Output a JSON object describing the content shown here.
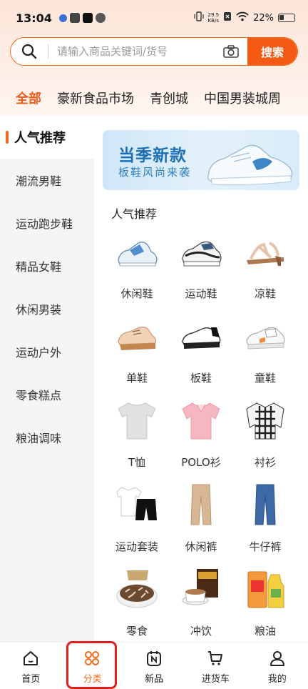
{
  "status_bar": {
    "time": "13:04",
    "net_speed_value": "29.5",
    "net_speed_unit": "KB/s",
    "battery": "22%"
  },
  "search": {
    "placeholder": "请输入商品关键词/货号",
    "button_label": "搜索",
    "icons": [
      "search-icon",
      "camera-icon"
    ]
  },
  "market_tabs": [
    {
      "label": "全部",
      "active": true
    },
    {
      "label": "豪新食品市场",
      "active": false
    },
    {
      "label": "青创城",
      "active": false
    },
    {
      "label": "中国男装城周",
      "active": false
    }
  ],
  "sidebar": {
    "items": [
      {
        "label": "人气推荐",
        "active": true
      },
      {
        "label": "潮流男鞋",
        "active": false
      },
      {
        "label": "运动跑步鞋",
        "active": false
      },
      {
        "label": "精品女鞋",
        "active": false
      },
      {
        "label": "休闲男装",
        "active": false
      },
      {
        "label": "运动户外",
        "active": false
      },
      {
        "label": "零食糕点",
        "active": false
      },
      {
        "label": "粮油调味",
        "active": false
      }
    ]
  },
  "banner": {
    "title": "当季新款",
    "subtitle": "板鞋风尚来袭"
  },
  "section": {
    "title": "人气推荐"
  },
  "categories": [
    {
      "label": "休闲鞋",
      "icon": "casual-shoe-icon"
    },
    {
      "label": "运动鞋",
      "icon": "sneaker-icon"
    },
    {
      "label": "凉鞋",
      "icon": "sandal-icon"
    },
    {
      "label": "单鞋",
      "icon": "oxford-shoe-icon"
    },
    {
      "label": "板鞋",
      "icon": "skate-shoe-icon"
    },
    {
      "label": "童鞋",
      "icon": "kids-shoe-icon"
    },
    {
      "label": "T恤",
      "icon": "tshirt-icon"
    },
    {
      "label": "POLO衫",
      "icon": "polo-shirt-icon"
    },
    {
      "label": "衬衫",
      "icon": "plaid-shirt-icon"
    },
    {
      "label": "运动套装",
      "icon": "sport-suit-icon"
    },
    {
      "label": "休闲裤",
      "icon": "casual-pants-icon"
    },
    {
      "label": "牛仔裤",
      "icon": "jeans-icon"
    },
    {
      "label": "零食",
      "icon": "sunflower-seeds-icon"
    },
    {
      "label": "冲饮",
      "icon": "coffee-icon"
    },
    {
      "label": "粮油",
      "icon": "cooking-oil-icon"
    }
  ],
  "bottom_nav": [
    {
      "label": "首页",
      "icon": "home-icon",
      "active": false
    },
    {
      "label": "分类",
      "icon": "category-icon",
      "active": true
    },
    {
      "label": "新品",
      "icon": "new-products-icon",
      "active": false
    },
    {
      "label": "进货车",
      "icon": "cart-icon",
      "active": false
    },
    {
      "label": "我的",
      "icon": "user-icon",
      "active": false
    }
  ],
  "colors": {
    "accent": "#f55a14",
    "highlight": "#e0201c"
  }
}
